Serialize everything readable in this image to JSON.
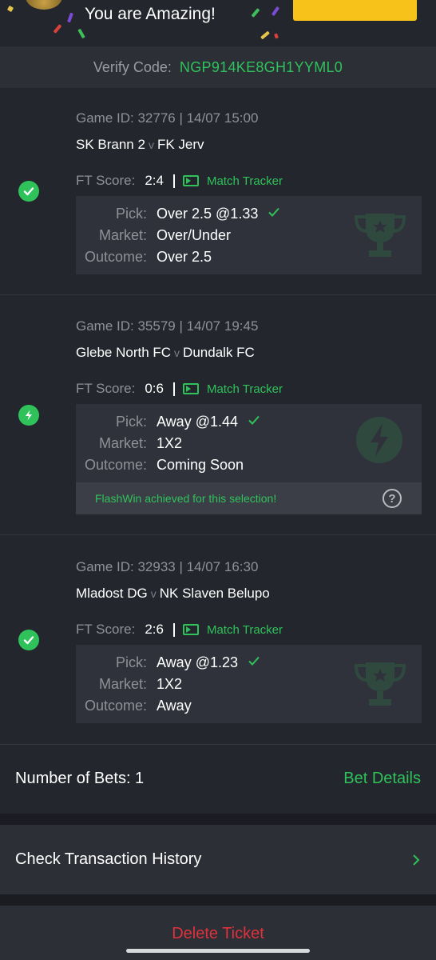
{
  "banner": {
    "title": "You are Amazing!"
  },
  "verify": {
    "label": "Verify Code:",
    "code": "NGP914KE8GH1YYML0"
  },
  "selections": [
    {
      "status": "won",
      "status_icon": "check-circle-icon",
      "game_id": "Game ID: 32776 | 14/07 15:00",
      "home": "SK Brann 2",
      "vs": "v",
      "away": "FK Jerv",
      "ft_label": "FT Score:",
      "ft_score": "2:4",
      "tracker": "Match Tracker",
      "pick_label": "Pick:",
      "pick": "Over 2.5 @1.33",
      "market_label": "Market:",
      "market": "Over/Under",
      "outcome_label": "Outcome:",
      "outcome": "Over 2.5",
      "watermark_icon": "trophy-icon"
    },
    {
      "status": "flashwin",
      "status_icon": "lightning-icon",
      "game_id": "Game ID: 35579 | 14/07 19:45",
      "home": "Glebe North FC",
      "vs": "v",
      "away": "Dundalk FC",
      "ft_label": "FT Score:",
      "ft_score": "0:6",
      "tracker": "Match Tracker",
      "pick_label": "Pick:",
      "pick": "Away @1.44",
      "market_label": "Market:",
      "market": "1X2",
      "outcome_label": "Outcome:",
      "outcome": "Coming Soon",
      "flash_message": "FlashWin achieved for this selection!",
      "watermark_icon": "lightning-icon"
    },
    {
      "status": "won",
      "status_icon": "check-circle-icon",
      "game_id": "Game ID: 32933 | 14/07 16:30",
      "home": "Mladost DG",
      "vs": "v",
      "away": "NK Slaven Belupo",
      "ft_label": "FT Score:",
      "ft_score": "2:6",
      "tracker": "Match Tracker",
      "pick_label": "Pick:",
      "pick": "Away @1.23",
      "market_label": "Market:",
      "market": "1X2",
      "outcome_label": "Outcome:",
      "outcome": "Away",
      "watermark_icon": "trophy-icon"
    }
  ],
  "bets": {
    "label": "Number of Bets: 1",
    "details_link": "Bet Details"
  },
  "history": {
    "label": "Check Transaction History"
  },
  "delete": {
    "label": "Delete Ticket"
  },
  "colors": {
    "accent": "#2fc25b",
    "danger": "#e0313d",
    "banner_button": "#f7c21a",
    "background": "#1a1c21"
  }
}
